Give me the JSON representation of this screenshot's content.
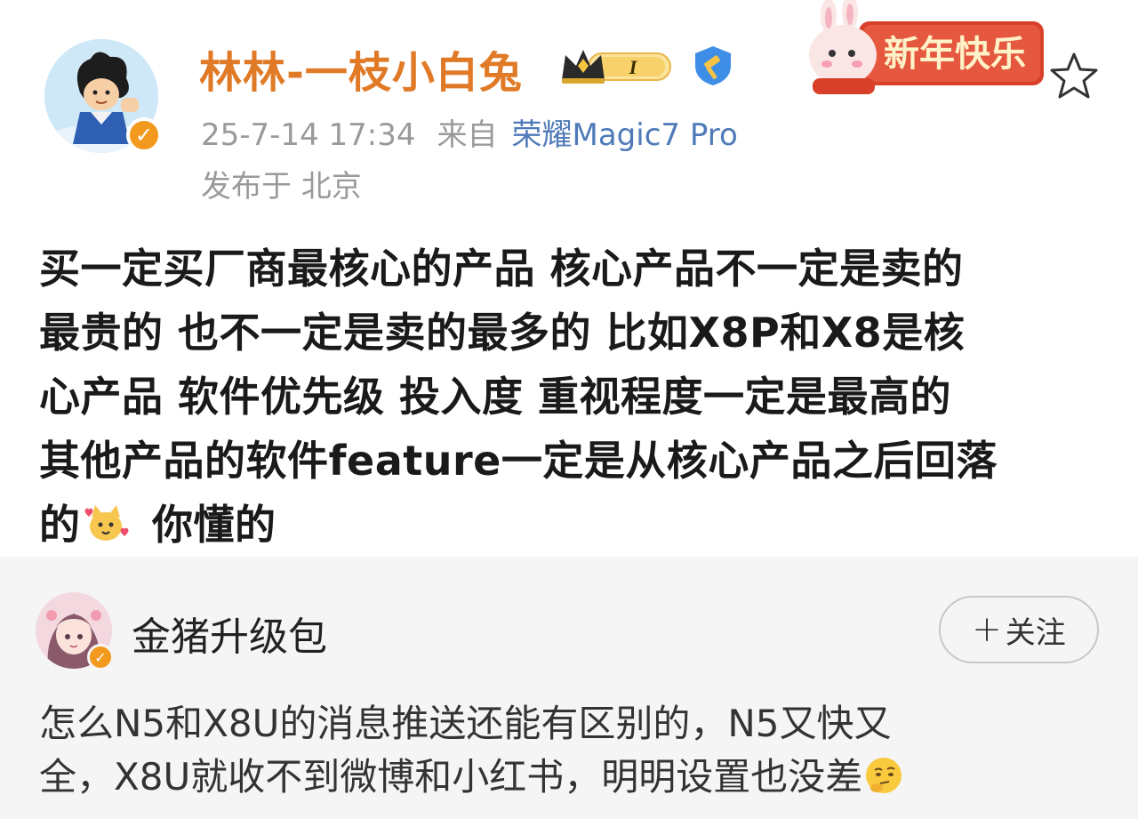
{
  "post": {
    "author": {
      "name": "林林-一枝小白兔",
      "level_badge": "I",
      "avatar_icon": "cartoon-boy-avatar",
      "verified_icon": "verified-v-icon"
    },
    "timestamp": "25-7-14 17:34",
    "source_prefix": "来自",
    "device": "荣耀Magic7 Pro",
    "location": "发布于 北京",
    "decoration_text": "新年快乐",
    "text_lines": [
      "买一定买厂商最核心的产品 核心产品不一定是卖的",
      "最贵的 也不一定是卖的最多的 比如X8P和X8是核",
      "心产品 软件优先级 投入度 重视程度一定是最高的",
      "其他产品的软件feature一定是从核心产品之后回落"
    ],
    "last_line_before_emoji": "的",
    "last_line_after_emoji": " 你懂的"
  },
  "comment": {
    "author": {
      "name": "金猪升级包",
      "avatar_icon": "anime-girl-avatar"
    },
    "follow_plus": "+",
    "follow_label": "关注",
    "text_lines": [
      "怎么N5和X8U的消息推送还能有区别的，N5又快又",
      "全，X8U就收不到微博和小红书，明明设置也没差"
    ]
  },
  "colors": {
    "username": "#e07a26",
    "device_link": "#4f7ab8",
    "meta_gray": "#9a9a9a",
    "comment_bg": "#f5f5f5",
    "verified_orange": "#f39a1e"
  }
}
